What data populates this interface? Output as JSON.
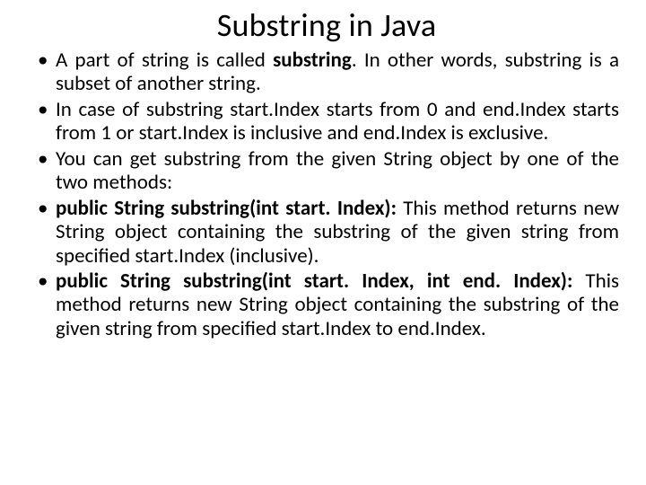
{
  "slide": {
    "title": "Substring in Java",
    "bullets": [
      {
        "pre": "A part of string is called ",
        "bold": "substring",
        "post": ". In other words, substring is a subset of another string."
      },
      {
        "pre": "In case of substring start.Index starts from 0 and end.Index starts from 1 or start.Index is inclusive and end.Index is exclusive.",
        "bold": "",
        "post": ""
      },
      {
        "pre": "You can get substring from the given String object by one of the two methods:",
        "bold": "",
        "post": ""
      },
      {
        "pre": "",
        "bold": "public String substring(int start. Index): ",
        "post": "This method returns new String object containing the substring of the given string from specified start.Index (inclusive)."
      },
      {
        "pre": "",
        "bold": "public String substring(int start. Index, int end. Index): ",
        "post": "This method returns new String object containing the substring of the given string from specified start.Index to end.Index."
      }
    ]
  }
}
